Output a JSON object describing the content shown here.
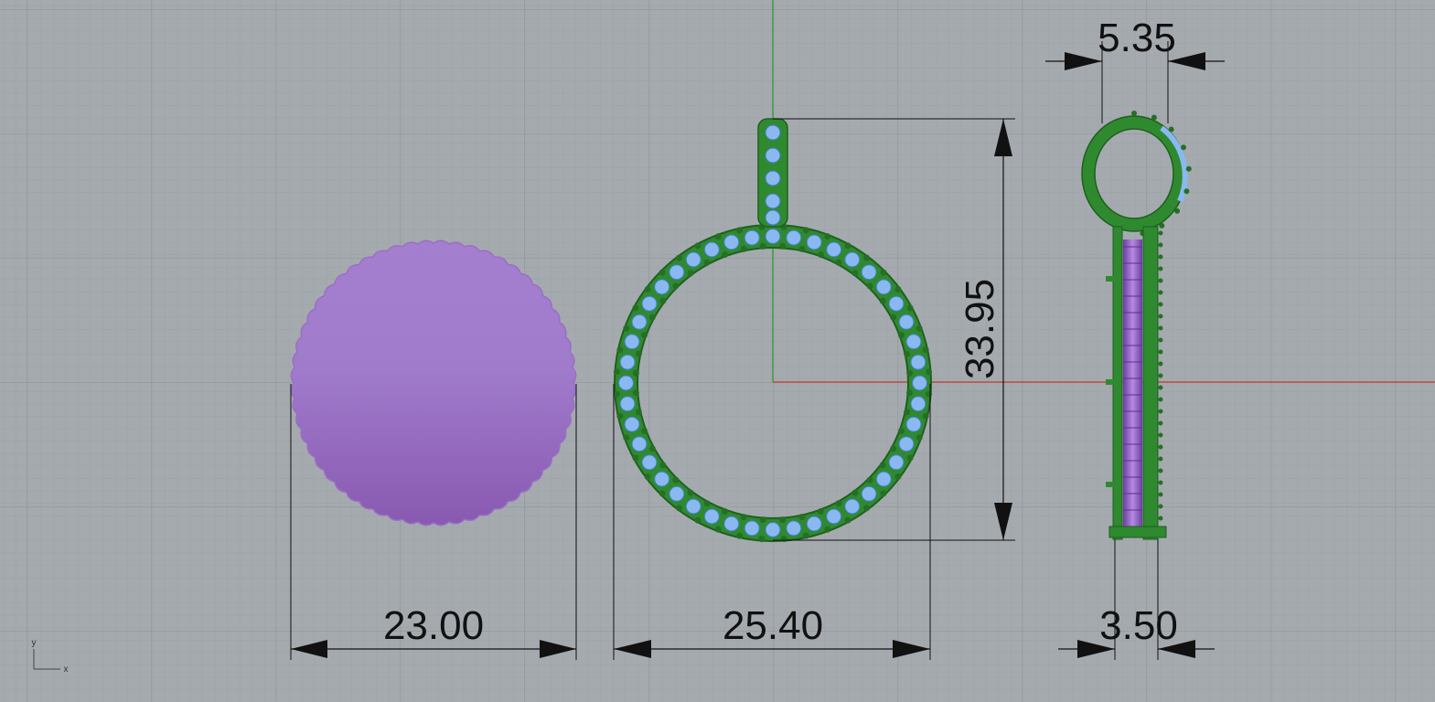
{
  "app": {
    "view": "Front viewport",
    "background": "#a5aaaf"
  },
  "axes": {
    "x_label": "x",
    "y_label": "y",
    "x_axis_color": "#c0392b",
    "y_axis_color": "#2e9a2e"
  },
  "dimensions": {
    "disc_width": "23.00",
    "ring_width": "25.40",
    "pendant_height": "33.95",
    "side_top_width": "5.35",
    "side_bottom_width": "3.50"
  },
  "objects": {
    "disc_color": "#9a6ec4",
    "metal_color": "#2f8a2f",
    "stone_color": "#8ab8f0"
  }
}
